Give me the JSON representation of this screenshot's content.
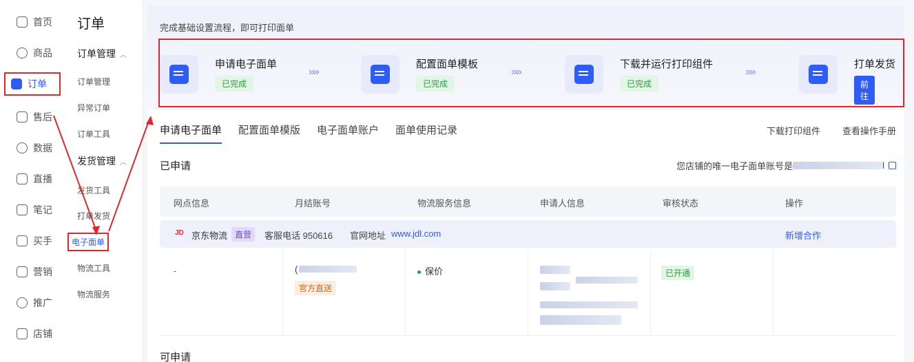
{
  "nav": {
    "items": [
      {
        "label": "首页",
        "icon": "home-icon"
      },
      {
        "label": "商品",
        "icon": "goods-icon"
      },
      {
        "label": "订单",
        "icon": "order-icon",
        "active": true
      },
      {
        "label": "售后",
        "icon": "aftersale-icon"
      },
      {
        "label": "数据",
        "icon": "data-icon"
      },
      {
        "label": "直播",
        "icon": "live-icon"
      },
      {
        "label": "笔记",
        "icon": "note-icon"
      },
      {
        "label": "买手",
        "icon": "buyer-icon"
      },
      {
        "label": "营销",
        "icon": "marketing-icon"
      },
      {
        "label": "推广",
        "icon": "promotion-icon"
      },
      {
        "label": "店铺",
        "icon": "store-icon"
      }
    ]
  },
  "subnav": {
    "title": "订单",
    "group1": "订单管理",
    "group1_items": [
      "订单管理",
      "异常订单",
      "订单工具"
    ],
    "group2": "发货管理",
    "group2_items": [
      "发货工具",
      "打单发货",
      "电子面单",
      "物流工具",
      "物流服务"
    ]
  },
  "hero": {
    "tip": "完成基础设置流程，即可打印面单",
    "steps": [
      {
        "name": "申请电子面单",
        "status": "已完成"
      },
      {
        "name": "配置面单模板",
        "status": "已完成"
      },
      {
        "name": "下载并运行打印组件",
        "status": "已完成"
      },
      {
        "name": "打单发货",
        "action": "前往"
      }
    ],
    "arrow": "»»"
  },
  "tabs": [
    "申请电子面单",
    "配置面单模版",
    "电子面单账户",
    "面单使用记录"
  ],
  "tab_links": [
    "下载打印组件",
    "查看操作手册"
  ],
  "applied": {
    "title": "已申请",
    "account_label": "您店铺的唯一电子面单账号是",
    "account_tail": "l"
  },
  "table": {
    "headers": [
      "网点信息",
      "月结账号",
      "物流服务信息",
      "申请人信息",
      "审核状态",
      "操作"
    ],
    "carrier": {
      "logo": "JD",
      "name": "京东物流",
      "tag": "直营",
      "phone": "客服电话 950616",
      "site_label": "官网地址",
      "site": "www.jdl.com",
      "action": "新增合作"
    },
    "row": {
      "branch": "-",
      "account_prefix": "(",
      "account_tag": "官方直送",
      "service": "保价",
      "status": "已开通"
    }
  },
  "available": {
    "title": "可申请"
  }
}
